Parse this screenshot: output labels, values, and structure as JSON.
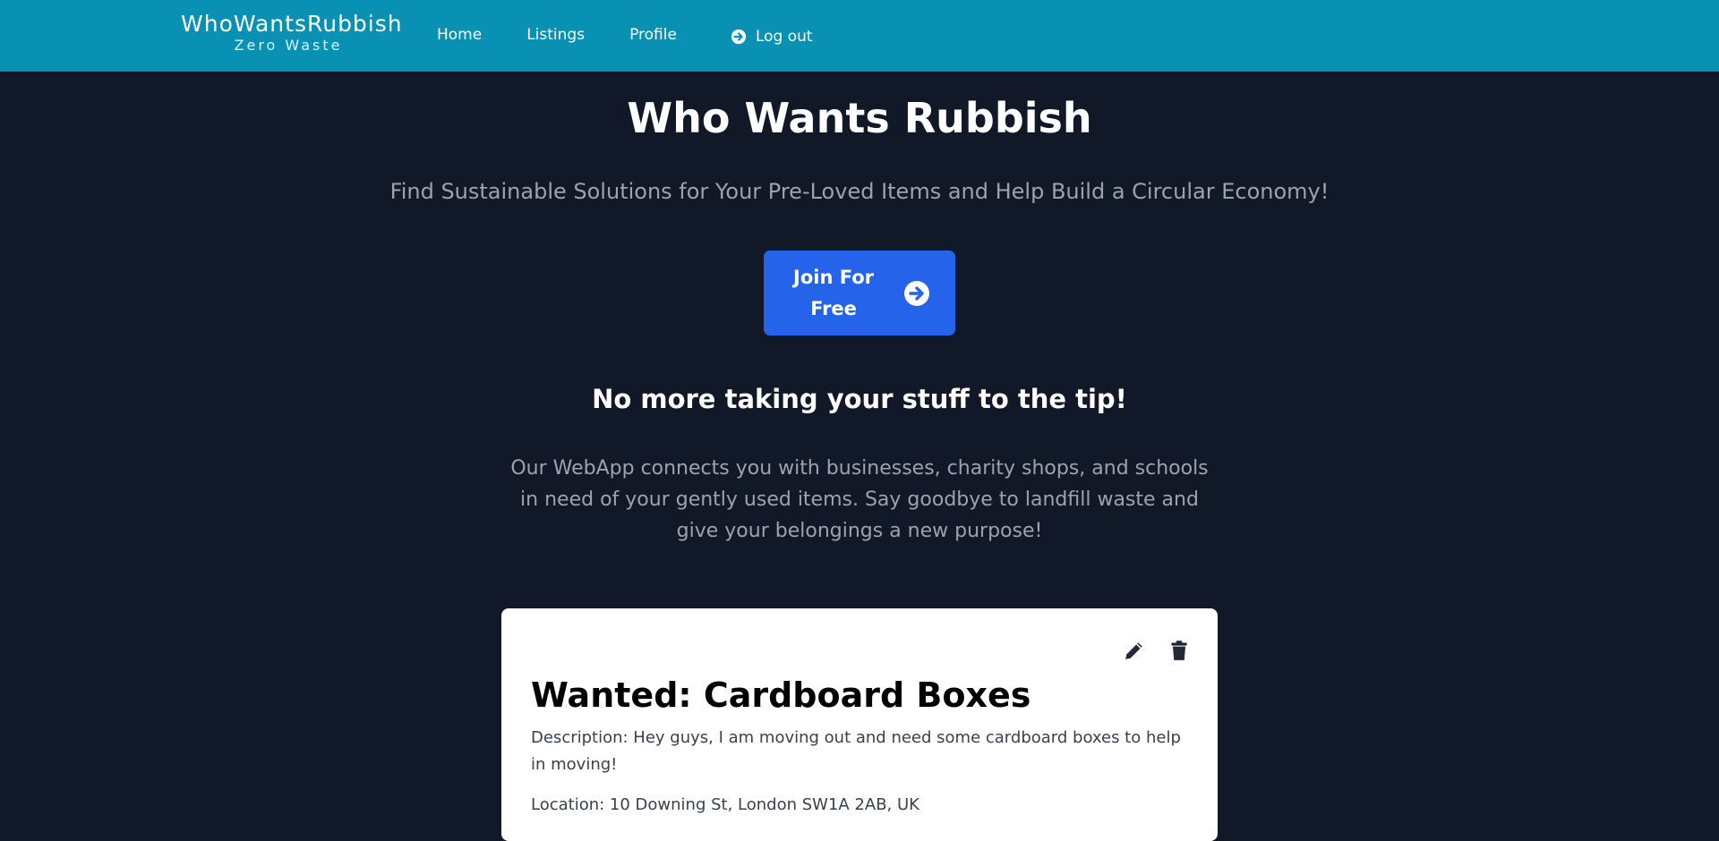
{
  "navbar": {
    "logo_main": "WhoWantsRubbish",
    "logo_sub": "Zero Waste",
    "links": [
      {
        "label": "Home"
      },
      {
        "label": "Listings"
      },
      {
        "label": "Profile"
      }
    ],
    "logout_label": "Log out",
    "logout_icon": "arrow-circle-right-icon",
    "background": "#0891b2"
  },
  "hero": {
    "title": "Who Wants Rubbish",
    "subtitle": "Find Sustainable Solutions for Your Pre-Loved Items and Help Build a Circular Economy!",
    "join_button_label": "Join For Free",
    "join_button_icon": "arrow-circle-right-icon",
    "join_button_color": "#2563eb",
    "tagline": "No more taking your stuff to the tip!",
    "intro": "Our WebApp connects you with businesses, charity shops, and schools in need of your gently used items. Say goodbye to landfill waste and give your belongings a new purpose!"
  },
  "listing": {
    "title": "Wanted: Cardboard Boxes",
    "description": "Description: Hey guys, I am moving out and need some cardboard boxes to help in moving!",
    "location": "Location: 10 Downing St, London SW1A 2AB, UK",
    "actions": [
      {
        "icon": "pencil-icon"
      },
      {
        "icon": "trash-icon"
      }
    ]
  },
  "page_background": "#111827"
}
